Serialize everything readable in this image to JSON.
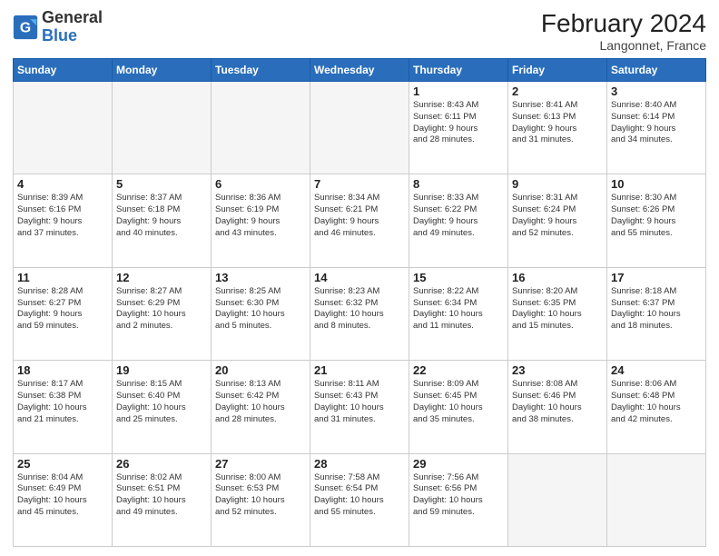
{
  "header": {
    "logo_general": "General",
    "logo_blue": "Blue",
    "month_year": "February 2024",
    "location": "Langonnet, France"
  },
  "weekdays": [
    "Sunday",
    "Monday",
    "Tuesday",
    "Wednesday",
    "Thursday",
    "Friday",
    "Saturday"
  ],
  "weeks": [
    [
      {
        "day": "",
        "info": ""
      },
      {
        "day": "",
        "info": ""
      },
      {
        "day": "",
        "info": ""
      },
      {
        "day": "",
        "info": ""
      },
      {
        "day": "1",
        "info": "Sunrise: 8:43 AM\nSunset: 6:11 PM\nDaylight: 9 hours\nand 28 minutes."
      },
      {
        "day": "2",
        "info": "Sunrise: 8:41 AM\nSunset: 6:13 PM\nDaylight: 9 hours\nand 31 minutes."
      },
      {
        "day": "3",
        "info": "Sunrise: 8:40 AM\nSunset: 6:14 PM\nDaylight: 9 hours\nand 34 minutes."
      }
    ],
    [
      {
        "day": "4",
        "info": "Sunrise: 8:39 AM\nSunset: 6:16 PM\nDaylight: 9 hours\nand 37 minutes."
      },
      {
        "day": "5",
        "info": "Sunrise: 8:37 AM\nSunset: 6:18 PM\nDaylight: 9 hours\nand 40 minutes."
      },
      {
        "day": "6",
        "info": "Sunrise: 8:36 AM\nSunset: 6:19 PM\nDaylight: 9 hours\nand 43 minutes."
      },
      {
        "day": "7",
        "info": "Sunrise: 8:34 AM\nSunset: 6:21 PM\nDaylight: 9 hours\nand 46 minutes."
      },
      {
        "day": "8",
        "info": "Sunrise: 8:33 AM\nSunset: 6:22 PM\nDaylight: 9 hours\nand 49 minutes."
      },
      {
        "day": "9",
        "info": "Sunrise: 8:31 AM\nSunset: 6:24 PM\nDaylight: 9 hours\nand 52 minutes."
      },
      {
        "day": "10",
        "info": "Sunrise: 8:30 AM\nSunset: 6:26 PM\nDaylight: 9 hours\nand 55 minutes."
      }
    ],
    [
      {
        "day": "11",
        "info": "Sunrise: 8:28 AM\nSunset: 6:27 PM\nDaylight: 9 hours\nand 59 minutes."
      },
      {
        "day": "12",
        "info": "Sunrise: 8:27 AM\nSunset: 6:29 PM\nDaylight: 10 hours\nand 2 minutes."
      },
      {
        "day": "13",
        "info": "Sunrise: 8:25 AM\nSunset: 6:30 PM\nDaylight: 10 hours\nand 5 minutes."
      },
      {
        "day": "14",
        "info": "Sunrise: 8:23 AM\nSunset: 6:32 PM\nDaylight: 10 hours\nand 8 minutes."
      },
      {
        "day": "15",
        "info": "Sunrise: 8:22 AM\nSunset: 6:34 PM\nDaylight: 10 hours\nand 11 minutes."
      },
      {
        "day": "16",
        "info": "Sunrise: 8:20 AM\nSunset: 6:35 PM\nDaylight: 10 hours\nand 15 minutes."
      },
      {
        "day": "17",
        "info": "Sunrise: 8:18 AM\nSunset: 6:37 PM\nDaylight: 10 hours\nand 18 minutes."
      }
    ],
    [
      {
        "day": "18",
        "info": "Sunrise: 8:17 AM\nSunset: 6:38 PM\nDaylight: 10 hours\nand 21 minutes."
      },
      {
        "day": "19",
        "info": "Sunrise: 8:15 AM\nSunset: 6:40 PM\nDaylight: 10 hours\nand 25 minutes."
      },
      {
        "day": "20",
        "info": "Sunrise: 8:13 AM\nSunset: 6:42 PM\nDaylight: 10 hours\nand 28 minutes."
      },
      {
        "day": "21",
        "info": "Sunrise: 8:11 AM\nSunset: 6:43 PM\nDaylight: 10 hours\nand 31 minutes."
      },
      {
        "day": "22",
        "info": "Sunrise: 8:09 AM\nSunset: 6:45 PM\nDaylight: 10 hours\nand 35 minutes."
      },
      {
        "day": "23",
        "info": "Sunrise: 8:08 AM\nSunset: 6:46 PM\nDaylight: 10 hours\nand 38 minutes."
      },
      {
        "day": "24",
        "info": "Sunrise: 8:06 AM\nSunset: 6:48 PM\nDaylight: 10 hours\nand 42 minutes."
      }
    ],
    [
      {
        "day": "25",
        "info": "Sunrise: 8:04 AM\nSunset: 6:49 PM\nDaylight: 10 hours\nand 45 minutes."
      },
      {
        "day": "26",
        "info": "Sunrise: 8:02 AM\nSunset: 6:51 PM\nDaylight: 10 hours\nand 49 minutes."
      },
      {
        "day": "27",
        "info": "Sunrise: 8:00 AM\nSunset: 6:53 PM\nDaylight: 10 hours\nand 52 minutes."
      },
      {
        "day": "28",
        "info": "Sunrise: 7:58 AM\nSunset: 6:54 PM\nDaylight: 10 hours\nand 55 minutes."
      },
      {
        "day": "29",
        "info": "Sunrise: 7:56 AM\nSunset: 6:56 PM\nDaylight: 10 hours\nand 59 minutes."
      },
      {
        "day": "",
        "info": ""
      },
      {
        "day": "",
        "info": ""
      }
    ]
  ]
}
